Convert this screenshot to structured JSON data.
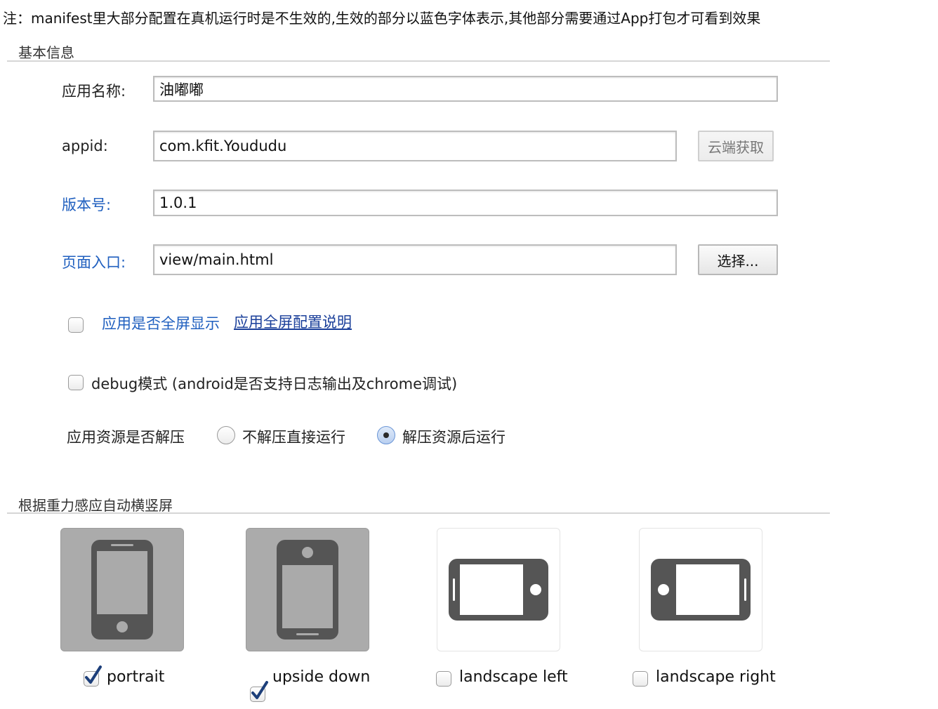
{
  "note": "注：manifest里大部分配置在真机运行时是不生效的,生效的部分以蓝色字体表示,其他部分需要通过App打包才可看到效果",
  "basic": {
    "section_title": "基本信息",
    "app_name": {
      "label": "应用名称:",
      "value": "油嘟嘟"
    },
    "appid": {
      "label": "appid:",
      "value": "com.kfit.Yoududu",
      "button": "云端获取"
    },
    "version": {
      "label": "版本号:",
      "value": "1.0.1"
    },
    "entry": {
      "label": "页面入口:",
      "value": "view/main.html",
      "button": "选择..."
    },
    "fullscreen": {
      "label": "应用是否全屏显示",
      "link": "应用全屏配置说明",
      "checked": false
    },
    "debug": {
      "label": "debug模式 (android是否支持日志输出及chrome调试)",
      "checked": false
    },
    "unzip": {
      "label": "应用资源是否解压",
      "options": [
        {
          "label": "不解压直接运行",
          "selected": false
        },
        {
          "label": "解压资源后运行",
          "selected": true
        }
      ]
    }
  },
  "orientation": {
    "section_title": "根据重力感应自动横竖屏",
    "items": [
      {
        "label": "portrait",
        "checked": true
      },
      {
        "label": "upside down",
        "checked": true
      },
      {
        "label": "landscape left",
        "checked": false
      },
      {
        "label": "landscape right",
        "checked": false
      }
    ]
  },
  "colors": {
    "blue_label": "#1f5fbf",
    "link": "#1a3f9a",
    "tile_active": "#ababab",
    "device": "#555555"
  },
  "icons": [
    "phone-portrait-icon",
    "phone-upside-down-icon",
    "phone-landscape-left-icon",
    "phone-landscape-right-icon",
    "checkmark-icon"
  ]
}
